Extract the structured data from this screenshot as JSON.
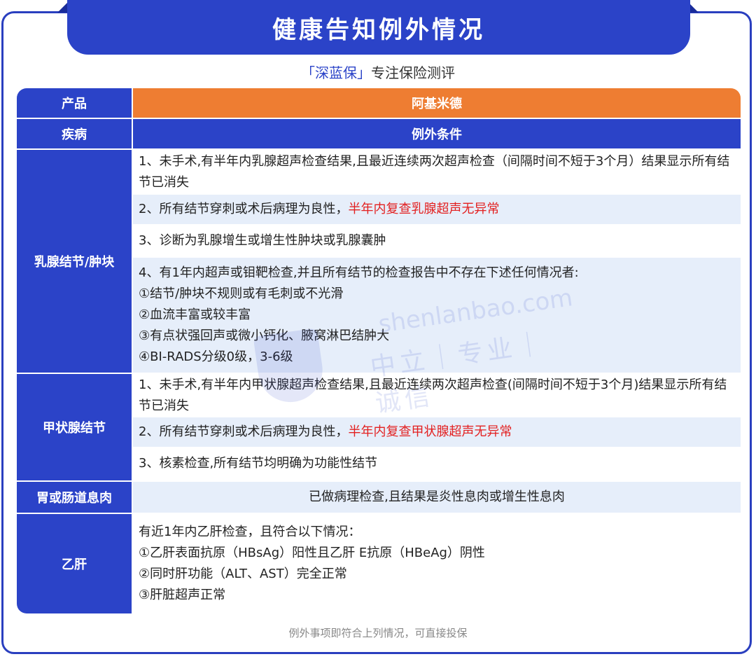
{
  "title": "健康告知例外情况",
  "subtitle": {
    "brand": "「深蓝保」",
    "tagline": "专注保险测评"
  },
  "watermark": {
    "line1": "shenlanbao.com",
    "line2": "中立｜专业｜诚信"
  },
  "table": {
    "product_label": "产品",
    "product_name": "阿基米德",
    "disease_label": "疾病",
    "condition_label": "例外条件",
    "breast": {
      "label": "乳腺结节/肿块",
      "item1": "1、未手术,有半年内乳腺超声检查结果,且最近连续两次超声检查（间隔时间不短于3个月）结果显示所有结节已消失",
      "item2_prefix": "2、所有结节穿刺或术后病理为良性，",
      "item2_highlight": "半年内复查乳腺超声无异常",
      "item3": "3、诊断为乳腺增生或增生性肿块或乳腺囊肿",
      "item4_lines": [
        "4、有1年内超声或钼靶检查,并且所有结节的检查报告中不存在下述任何情况者:",
        "①结节/肿块不规则或有毛刺或不光滑",
        "②血流丰富或较丰富",
        "③有点状强回声或微小钙化、腋窝淋巴结肿大",
        "④BI-RADS分级0级，3-6级"
      ]
    },
    "thyroid": {
      "label": "甲状腺结节",
      "item1": "1、未手术,有半年内甲状腺超声检查结果,且最近连续两次超声检查(间隔时间不短于3个月)结果显示所有结节已消失",
      "item2_prefix": "2、所有结节穿刺或术后病理为良性，",
      "item2_highlight": "半年内复查甲状腺超声无异常",
      "item3": "3、核素检查,所有结节均明确为功能性结节"
    },
    "polyp": {
      "label": "胃或肠道息肉",
      "text": "已做病理检查,且结果是炎性息肉或增生性息肉"
    },
    "hepatitis": {
      "label": "乙肝",
      "lines": [
        "有近1年内乙肝检查，且符合以下情况：",
        "①乙肝表面抗原（HBsAg）阳性且乙肝 E抗原（HBeAg）阴性",
        "②同时肝功能（ALT、AST）完全正常",
        "③肝脏超声正常"
      ]
    }
  },
  "footer": "例外事项即符合上列情况，可直接投保",
  "colors": {
    "primary_blue": "#2b43c8",
    "orange": "#ee7d32",
    "light_row": "#e6eefa",
    "highlight_red": "#e32020"
  }
}
